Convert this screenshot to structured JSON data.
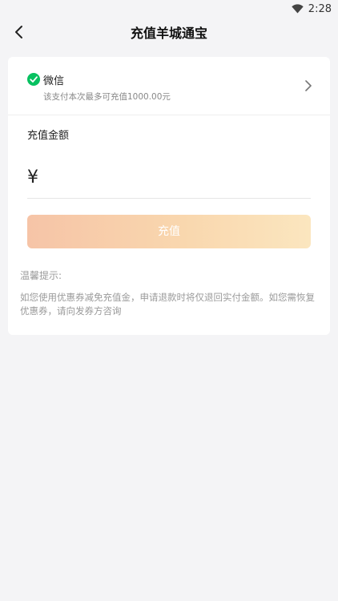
{
  "status_bar": {
    "time": "2:28"
  },
  "nav": {
    "title": "充值羊城通宝"
  },
  "payment": {
    "method_name": "微信",
    "limit_text": "该支付本次最多可充值1000.00元"
  },
  "amount": {
    "label": "充值金额",
    "currency_symbol": "¥",
    "value": ""
  },
  "submit": {
    "label": "充值"
  },
  "tips": {
    "title": "温馨提示:",
    "text": "如您使用优惠券减免充值金，申请退款时将仅退回实付金额。如您需恢复优惠券，请向发券方咨询"
  },
  "colors": {
    "wechat_green": "#07c160",
    "button_gradient_start": "#f6c4a7",
    "button_gradient_end": "#fbe6bf",
    "page_background": "#f4f4f6"
  }
}
